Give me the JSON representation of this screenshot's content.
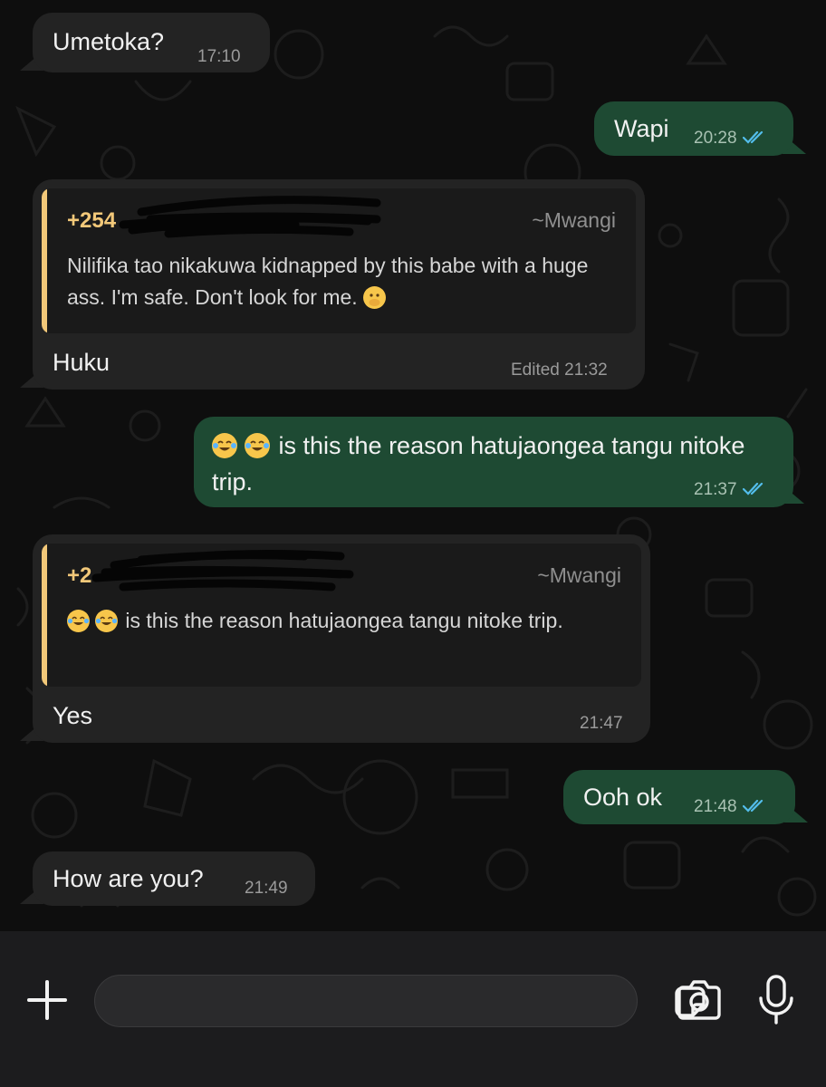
{
  "messages": [
    {
      "direction": "incoming",
      "text": "Umetoka?",
      "time": "17:10"
    },
    {
      "direction": "outgoing",
      "text": "Wapi",
      "time": "20:28",
      "status": "read"
    },
    {
      "direction": "incoming",
      "quote": {
        "sender": "+254",
        "name": "~Mwangi",
        "text": "Nilifika tao nikakuwa kidnapped by this babe with a huge ass. I'm safe. Don't look for me.",
        "emoji_icon": "face-with-hand-over-mouth-icon"
      },
      "text": "Huku",
      "time": "Edited 21:32"
    },
    {
      "direction": "outgoing",
      "emoji_icons": [
        "tears-of-joy-icon",
        "tears-of-joy-icon"
      ],
      "text": "is this the reason hatujaongea tangu nitoke trip.",
      "time": "21:37",
      "status": "read"
    },
    {
      "direction": "incoming",
      "quote": {
        "sender": "+2",
        "name": "~Mwangi",
        "emoji_icons": [
          "tears-of-joy-icon",
          "tears-of-joy-icon"
        ],
        "text": "is this the reason hatujaongea tangu nitoke trip."
      },
      "text": "Yes",
      "time": "21:47"
    },
    {
      "direction": "outgoing",
      "text": "Ooh ok",
      "time": "21:48",
      "status": "read"
    },
    {
      "direction": "incoming",
      "text": "How are you?",
      "time": "21:49"
    }
  ],
  "composer": {
    "placeholder": "",
    "icons": [
      "plus-icon",
      "sticker-icon",
      "camera-icon",
      "microphone-icon"
    ]
  },
  "colors": {
    "incoming_bubble": "#232323",
    "outgoing_bubble": "#1e4a33",
    "quote_accent": "#f2c879",
    "read_ticks": "#53bdeb"
  }
}
